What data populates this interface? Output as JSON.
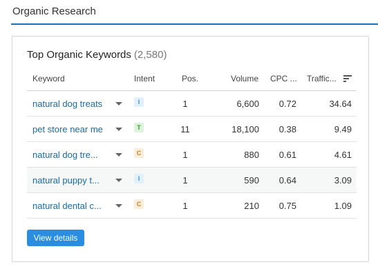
{
  "header": {
    "title": "Organic Research"
  },
  "card": {
    "title": "Top Organic Keywords",
    "count": "(2,580)"
  },
  "columns": {
    "keyword": "Keyword",
    "intent": "Intent",
    "pos": "Pos.",
    "volume": "Volume",
    "cpc": "CPC ...",
    "traffic": "Traffic..."
  },
  "rows": [
    {
      "keyword": "natural dog treats",
      "intent": "I",
      "intent_color": "#3c8fd1",
      "intent_bg": "#e2f0fb",
      "pos": "1",
      "volume": "6,600",
      "cpc": "0.72",
      "traffic": "34.64"
    },
    {
      "keyword": "pet store near me",
      "intent": "T",
      "intent_color": "#3a9a3a",
      "intent_bg": "#def3dc",
      "pos": "11",
      "volume": "18,100",
      "cpc": "0.38",
      "traffic": "9.49"
    },
    {
      "keyword": "natural dog tre...",
      "intent": "C",
      "intent_color": "#c8862b",
      "intent_bg": "#fbeed8",
      "pos": "1",
      "volume": "880",
      "cpc": "0.61",
      "traffic": "4.61"
    },
    {
      "keyword": "natural puppy t...",
      "intent": "I",
      "intent_color": "#3c8fd1",
      "intent_bg": "#e2f0fb",
      "pos": "1",
      "volume": "590",
      "cpc": "0.64",
      "traffic": "3.09"
    },
    {
      "keyword": "natural dental c...",
      "intent": "C",
      "intent_color": "#c8862b",
      "intent_bg": "#fbeed8",
      "pos": "1",
      "volume": "210",
      "cpc": "0.75",
      "traffic": "1.09"
    }
  ],
  "button": {
    "label": "View details"
  },
  "icons": {
    "caret": "chevron-down-icon",
    "sort": "sort-icon"
  }
}
